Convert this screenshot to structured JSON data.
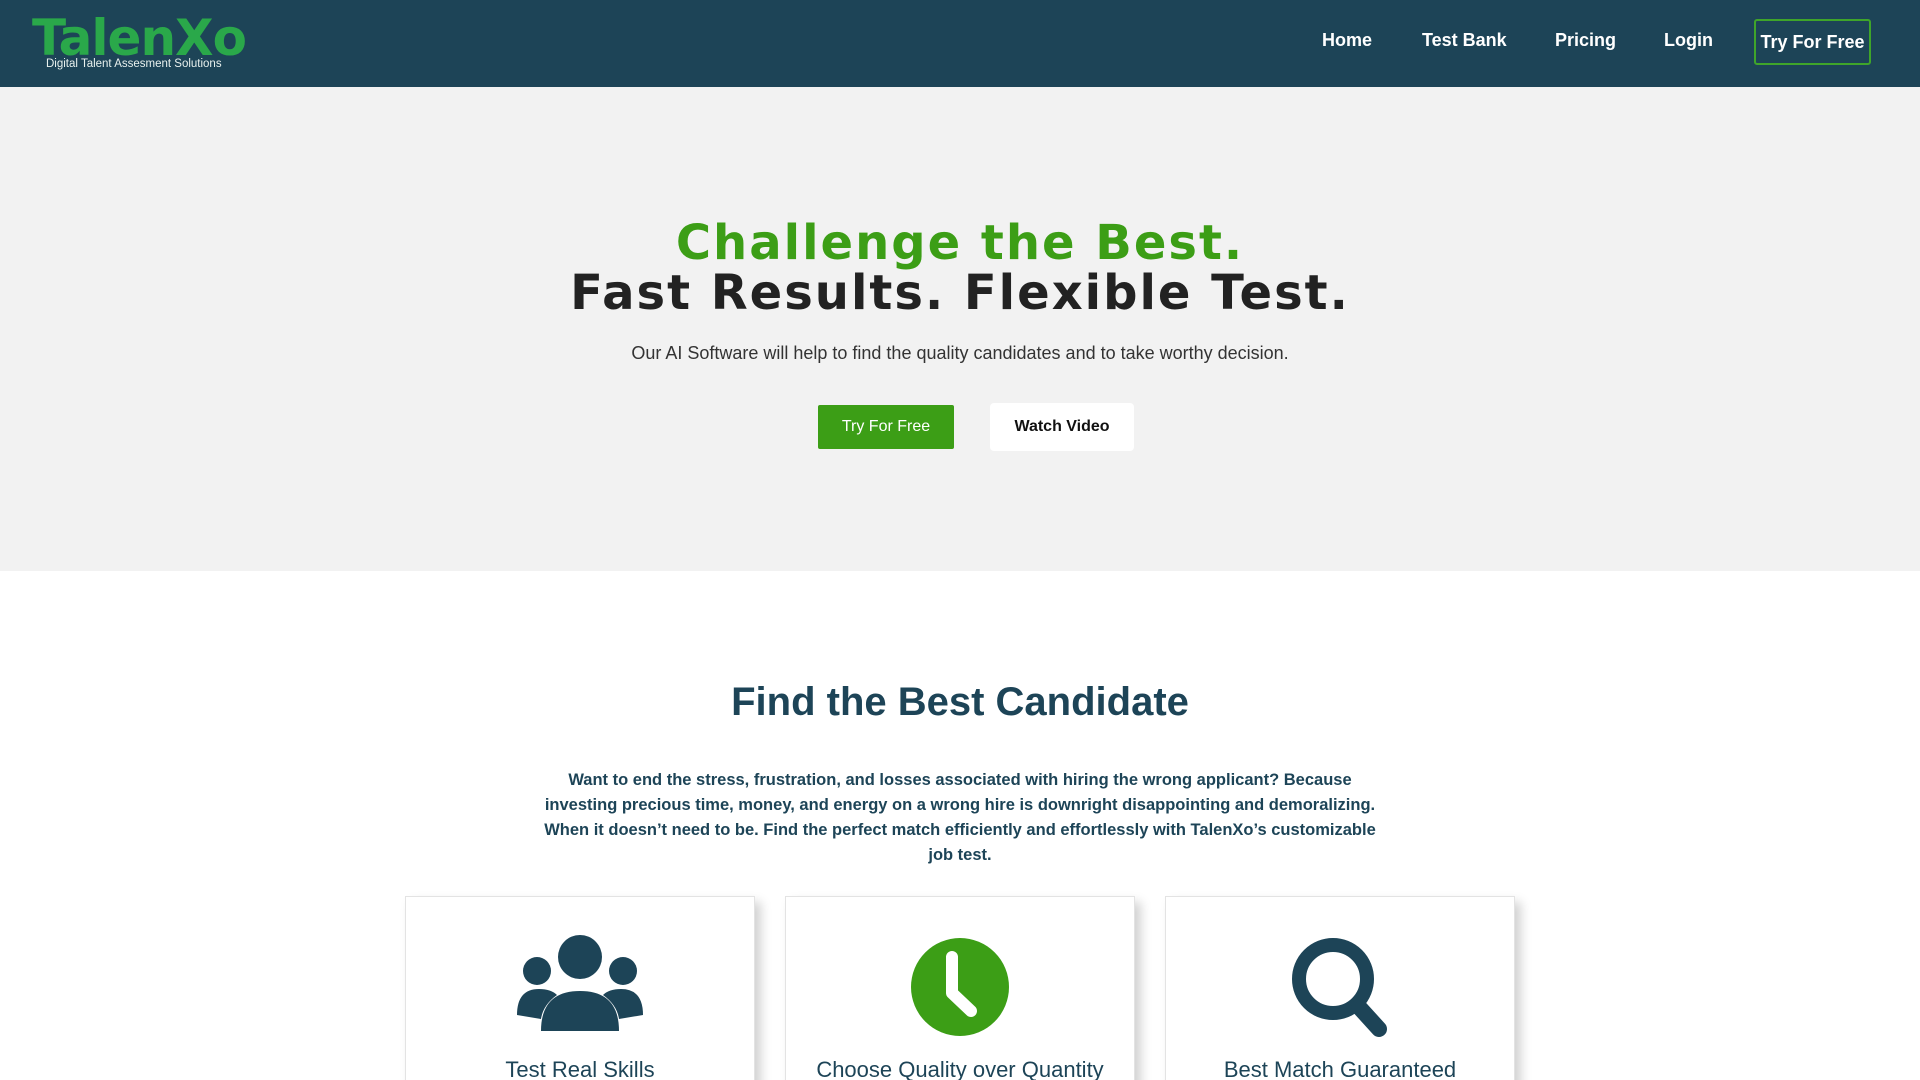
{
  "nav": {
    "logo_text": "TalenXo",
    "logo_tagline": "Digital Talent Assesment Solutions",
    "links": [
      "Home",
      "Test Bank",
      "Pricing",
      "Login"
    ],
    "cta_label": "Try For Free"
  },
  "hero": {
    "headline_1": "Challenge the Best.",
    "headline_2": "Fast Results. Flexible Test.",
    "subtitle": "Our AI Software will help to find the quality candidates and to take worthy decision.",
    "primary_button": "Try For Free",
    "secondary_button": "Watch Video"
  },
  "features": {
    "title": "Find the Best Candidate",
    "description": "Want to end the stress, frustration, and losses associated with hiring the wrong applicant? Because investing precious time, money, and energy on a wrong hire is downright disappointing and demoralizing. When it doesn’t need to be. Find the perfect match efficiently and effortlessly with TalenXo’s customizable job test.",
    "cards": [
      {
        "icon": "users-icon",
        "title": "Test Real Skills"
      },
      {
        "icon": "clock-icon",
        "title": "Choose Quality over Quantity"
      },
      {
        "icon": "search-icon",
        "title": "Best Match Guaranteed"
      }
    ]
  },
  "colors": {
    "nav_bg": "#1d4457",
    "brand_green": "#3c9e16",
    "logo_green": "#2aa84a",
    "hero_bg": "#f2f2f2",
    "heading_navy": "#1d4457"
  }
}
